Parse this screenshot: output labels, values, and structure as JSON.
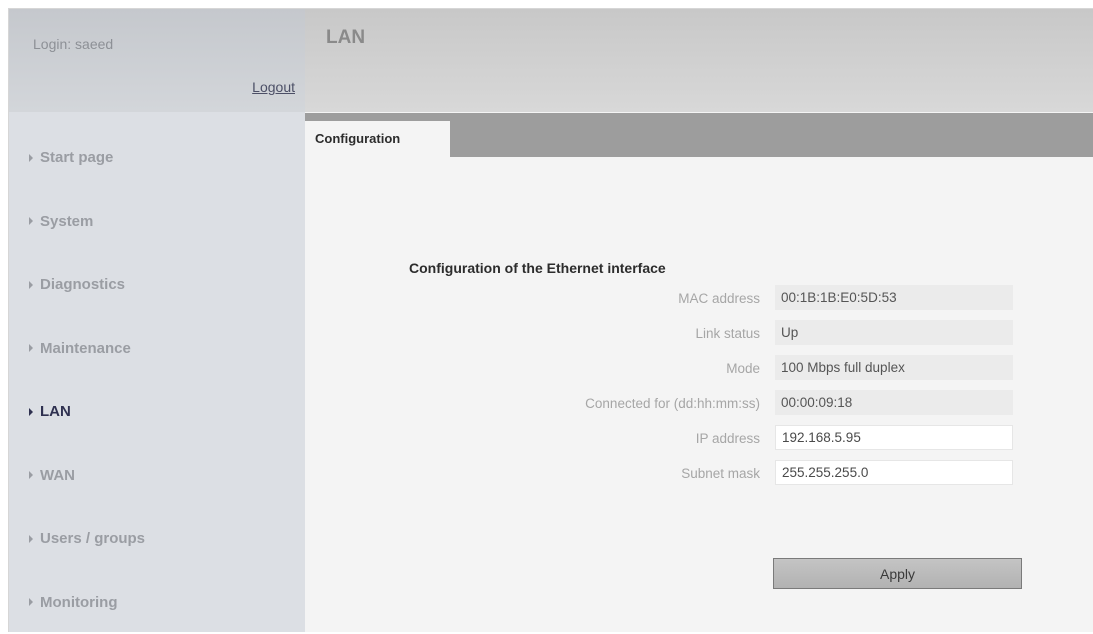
{
  "login": {
    "text": "Login: saeed",
    "logout_label": "Logout"
  },
  "nav": {
    "items": [
      {
        "label": "Start page",
        "active": false
      },
      {
        "label": "System",
        "active": false
      },
      {
        "label": "Diagnostics",
        "active": false
      },
      {
        "label": "Maintenance",
        "active": false
      },
      {
        "label": "LAN",
        "active": true
      },
      {
        "label": "WAN",
        "active": false
      },
      {
        "label": "Users / groups",
        "active": false
      },
      {
        "label": "Monitoring",
        "active": false
      }
    ]
  },
  "page": {
    "title": "LAN",
    "tabs": [
      {
        "label": "Configuration",
        "active": true
      }
    ]
  },
  "ethernet": {
    "section_title": "Configuration of the Ethernet interface",
    "fields": [
      {
        "label": "MAC address",
        "value": "00:1B:1B:E0:5D:53",
        "editable": false
      },
      {
        "label": "Link status",
        "value": "Up",
        "editable": false
      },
      {
        "label": "Mode",
        "value": "100 Mbps full duplex",
        "editable": false
      },
      {
        "label": "Connected for (dd:hh:mm:ss)",
        "value": "00:00:09:18",
        "editable": false
      },
      {
        "label": "IP address",
        "value": "192.168.5.95",
        "editable": true
      },
      {
        "label": "Subnet mask",
        "value": "255.255.255.0",
        "editable": true
      }
    ],
    "apply_label": "Apply"
  },
  "colors": {
    "active_nav": "#2f3150",
    "inactive_nav": "#9a9da3",
    "tab_bar": "#9d9d9d"
  }
}
